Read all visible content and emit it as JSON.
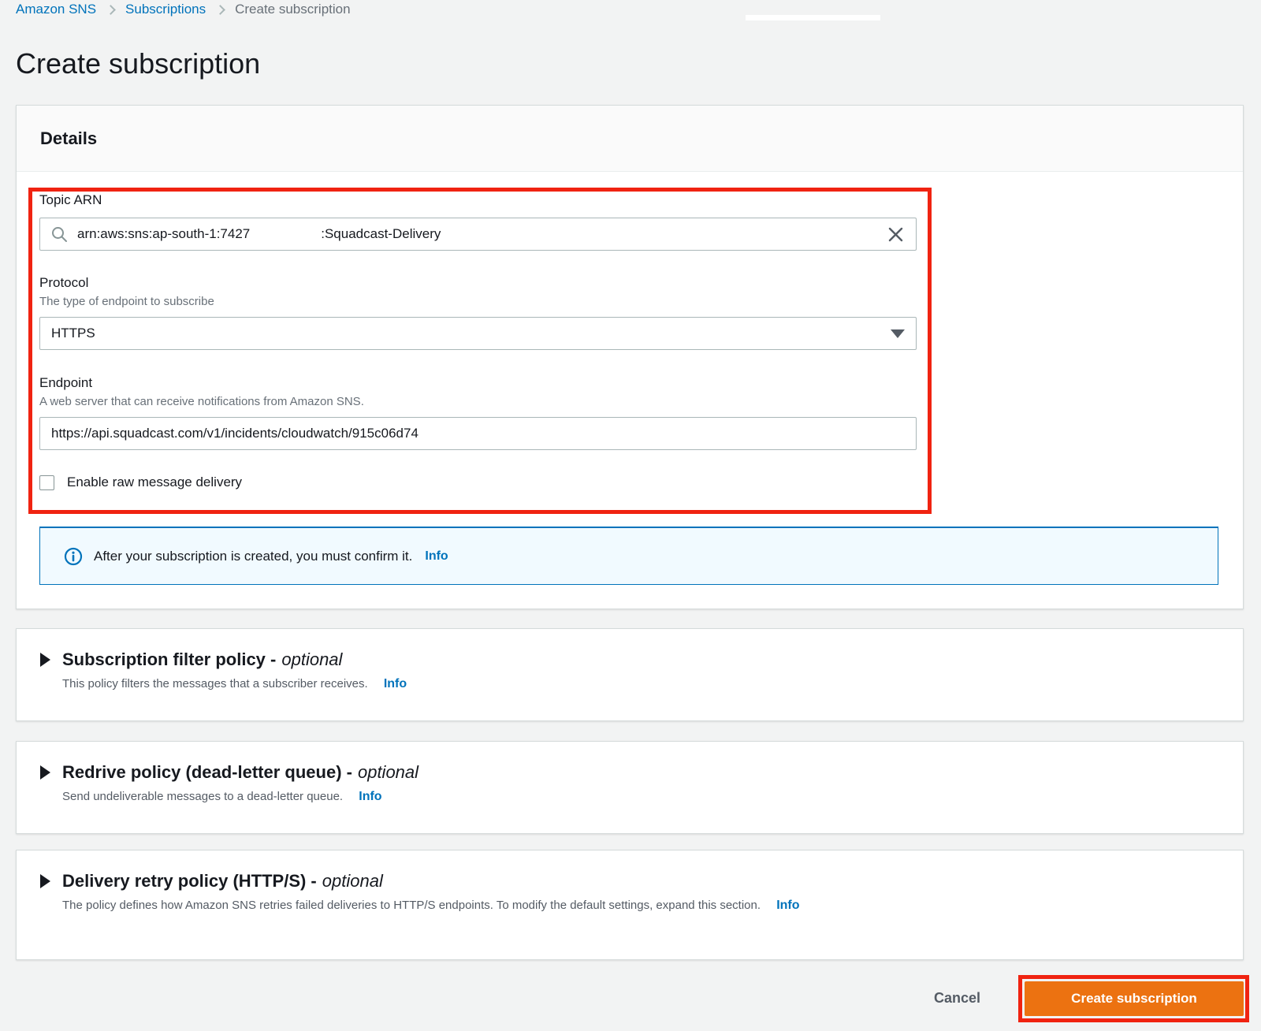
{
  "breadcrumb": {
    "items": [
      {
        "label": "Amazon SNS"
      },
      {
        "label": "Subscriptions"
      },
      {
        "label": "Create subscription"
      }
    ]
  },
  "page": {
    "title": "Create subscription"
  },
  "details": {
    "header": "Details",
    "topic_arn": {
      "label": "Topic ARN",
      "value_prefix": "arn:aws:sns:ap-south-1:7427",
      "value_suffix": ":Squadcast-Delivery"
    },
    "protocol": {
      "label": "Protocol",
      "description": "The type of endpoint to subscribe",
      "selected": "HTTPS"
    },
    "endpoint": {
      "label": "Endpoint",
      "description": "A web server that can receive notifications from Amazon SNS.",
      "value": "https://api.squadcast.com/v1/incidents/cloudwatch/915c06d74"
    },
    "raw_message_delivery": {
      "label": "Enable raw message delivery",
      "checked": false
    },
    "alert": {
      "text": "After your subscription is created, you must confirm it.",
      "link": "Info"
    }
  },
  "sections": [
    {
      "title": "Subscription filter policy -",
      "optional": "optional",
      "description": "This policy filters the messages that a subscriber receives.",
      "link": "Info"
    },
    {
      "title": "Redrive policy (dead-letter queue) -",
      "optional": "optional",
      "description": "Send undeliverable messages to a dead-letter queue.",
      "link": "Info"
    },
    {
      "title": "Delivery retry policy (HTTP/S) -",
      "optional": "optional",
      "description": "The policy defines how Amazon SNS retries failed deliveries to HTTP/S endpoints. To modify the default settings, expand this section.",
      "link": "Info"
    }
  ],
  "footer": {
    "cancel_label": "Cancel",
    "submit_label": "Create subscription"
  },
  "colors": {
    "link_blue": "#0073bb",
    "button_orange": "#ec7211",
    "annotation_red": "#f02311",
    "alert_bg": "#f1faff"
  }
}
